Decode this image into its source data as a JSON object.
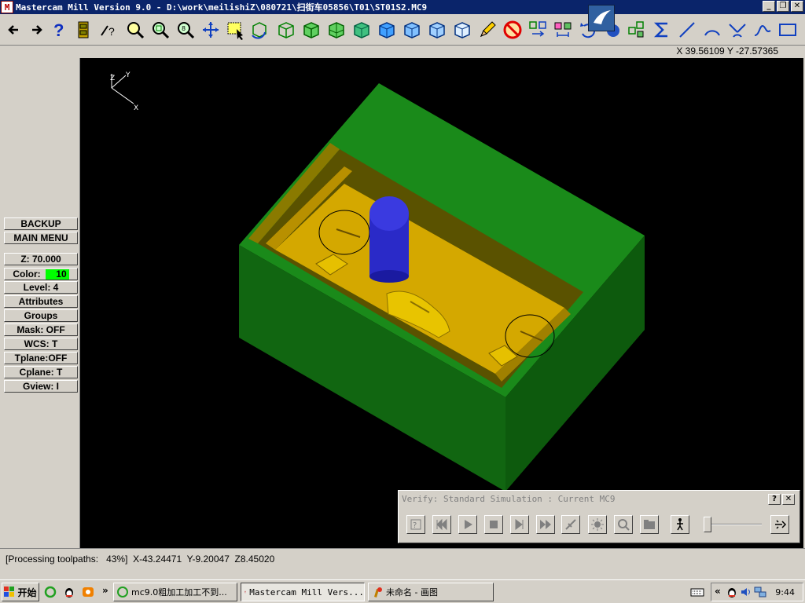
{
  "window": {
    "app_icon": "mastercam-icon",
    "title": "Mastercam Mill Version 9.0 - D:\\work\\meilishiZ\\080721\\扫街车05856\\T01\\ST01S2.MC9",
    "minimize": "_",
    "restore": "❐",
    "close": "✕"
  },
  "toolbar": {
    "icons": [
      "back-arrow-icon",
      "forward-arrow-icon",
      "help-icon",
      "file-cabinet-icon",
      "context-help-icon",
      "zoom-window-icon",
      "unzoom-icon",
      "zoom-fit-icon",
      "pan-icon",
      "select-icon",
      "rotate-view-icon",
      "wireframe-cube-icon",
      "shaded-cube-icon",
      "cube-top-icon",
      "cube-iso-icon",
      "cube-front-icon",
      "cube-side-icon",
      "cube-right-icon",
      "cube-back-icon",
      "pencil-icon",
      "no-entry-icon",
      "transform-icon",
      "mirror-icon",
      "undo-icon",
      "plugin-icon",
      "array-icon",
      "sigma-icon",
      "line-icon",
      "arc-icon",
      "fillet-icon",
      "spline-icon",
      "rectangle-icon"
    ]
  },
  "coord_readout": "X 39.56109  Y -27.57365",
  "left_menu": {
    "backup": "BACKUP",
    "main_menu": "MAIN MENU",
    "z": "Z:  70.000",
    "color_label": "Color:",
    "color_value": "10",
    "level": "Level:  4",
    "attributes": "Attributes",
    "groups": "Groups",
    "mask": "Mask:  OFF",
    "wcs": "WCS:   T",
    "tplane": "Tplane:OFF",
    "cplane": "Cplane:  T",
    "gview": "Gview:   I"
  },
  "viewport": {
    "axis_y": "Y",
    "axis_z": "Z",
    "axis_x": "X",
    "colors": {
      "stock": "#1a7a1a",
      "part": "#e6b800",
      "tool": "#2020c0",
      "background": "#000000"
    }
  },
  "verify": {
    "title": "Verify: Standard Simulation : Current MC9",
    "help": "?",
    "close": "✕",
    "controls": [
      "options-icon",
      "rewind-icon",
      "play-icon",
      "stop-icon",
      "step-icon",
      "fast-forward-icon",
      "tool-display-icon",
      "light-icon",
      "zoom-icon",
      "save-icon",
      "walk-icon",
      "speed-icon"
    ]
  },
  "status": "[Processing toolpaths:   43%]  X-43.24471  Y-9.20047  Z8.45020",
  "taskbar": {
    "start": "开始",
    "more": "»",
    "tasks": [
      "mc9.0粗加工加工不到...",
      "Mastercam Mill Vers...",
      "未命名 - 画图"
    ],
    "tray_expand": "«",
    "clock": "9:44"
  }
}
